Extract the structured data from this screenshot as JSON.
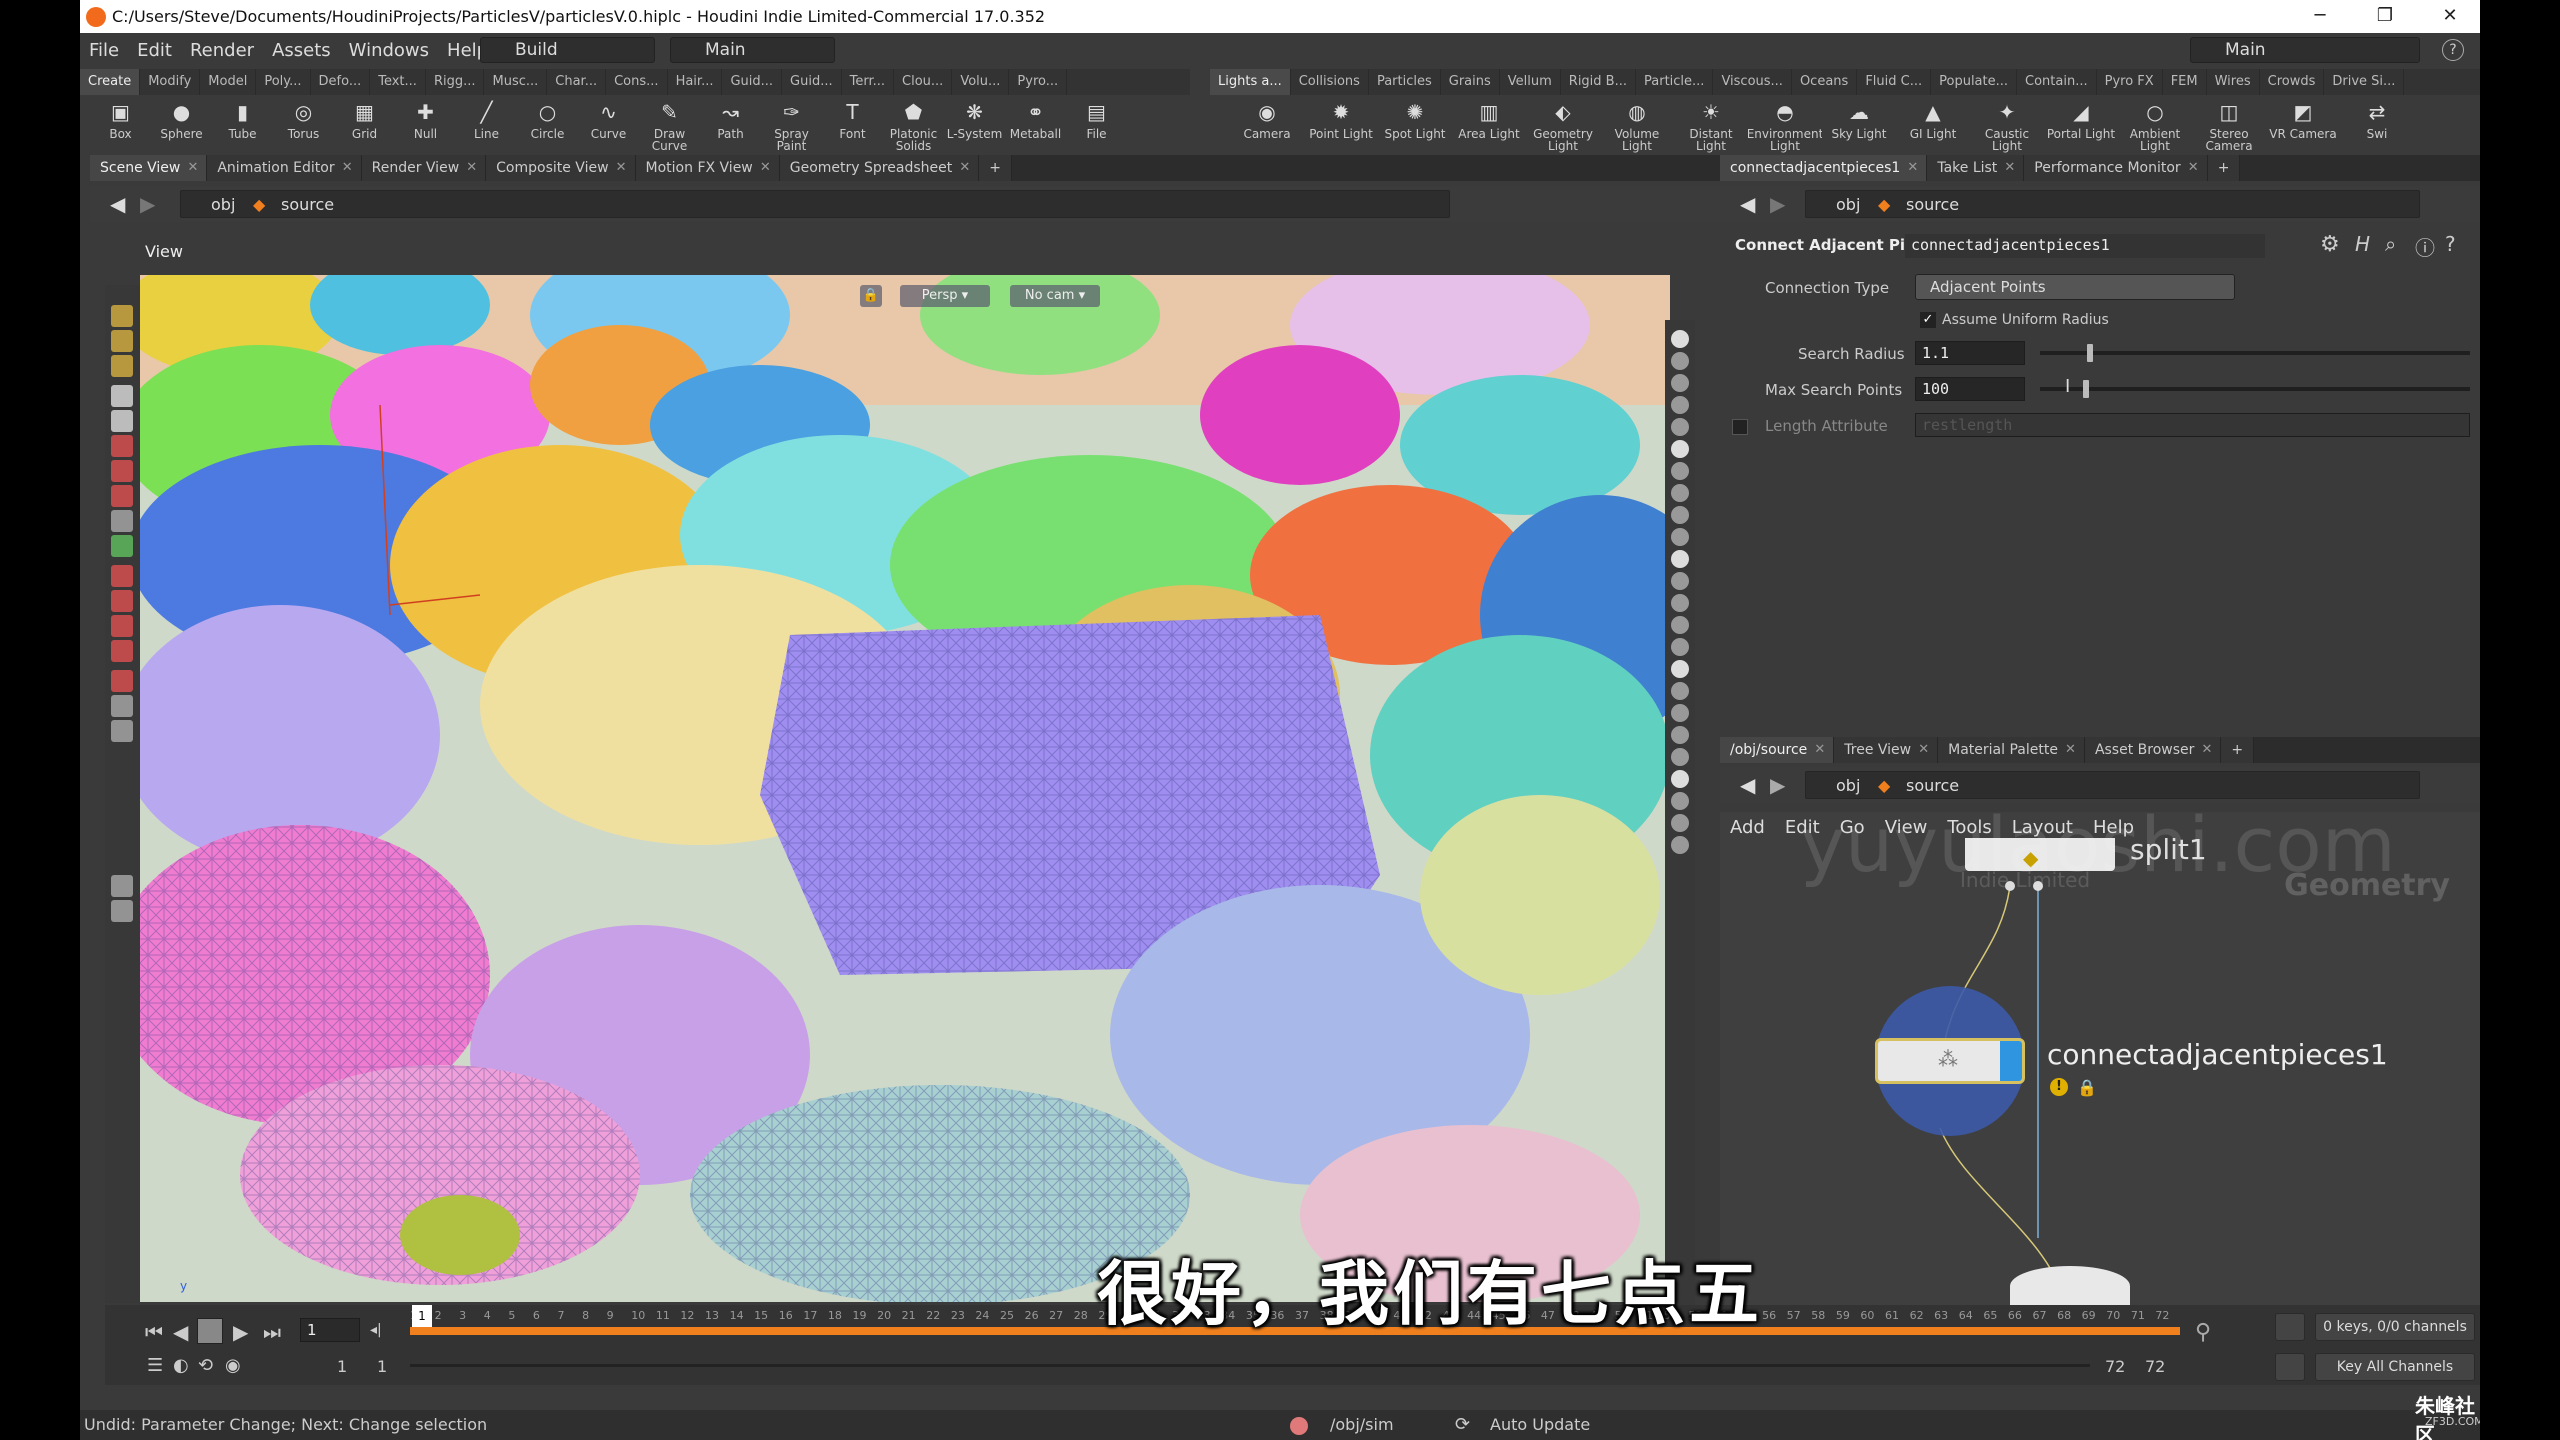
{
  "window": {
    "title": "C:/Users/Steve/Documents/HoudiniProjects/ParticlesV/particlesV.0.hiplc - Houdini Indie Limited-Commercial 17.0.352",
    "minimize": "─",
    "maximize": "❐",
    "close": "✕"
  },
  "menu": {
    "items": [
      "File",
      "Edit",
      "Render",
      "Assets",
      "Windows",
      "Help"
    ],
    "desktop": "Build",
    "main": "Main",
    "main_right": "Main",
    "help_icon": "?"
  },
  "shelf_left": {
    "tabs": [
      "Create",
      "Modify",
      "Model",
      "Poly...",
      "Defo...",
      "Text...",
      "Rigg...",
      "Musc...",
      "Char...",
      "Cons...",
      "Hair...",
      "Guid...",
      "Guid...",
      "Terr...",
      "Clou...",
      "Volu...",
      "Pyro..."
    ],
    "tools": [
      {
        "label": "Box",
        "icon": "box-icon"
      },
      {
        "label": "Sphere",
        "icon": "sphere-icon"
      },
      {
        "label": "Tube",
        "icon": "tube-icon"
      },
      {
        "label": "Torus",
        "icon": "torus-icon"
      },
      {
        "label": "Grid",
        "icon": "grid-icon"
      },
      {
        "label": "Null",
        "icon": "null-icon"
      },
      {
        "label": "Line",
        "icon": "line-icon"
      },
      {
        "label": "Circle",
        "icon": "circle-icon"
      },
      {
        "label": "Curve",
        "icon": "curve-icon"
      },
      {
        "label": "Draw Curve",
        "icon": "draw-curve-icon"
      },
      {
        "label": "Path",
        "icon": "path-icon"
      },
      {
        "label": "Spray Paint",
        "icon": "spray-paint-icon"
      },
      {
        "label": "Font",
        "icon": "font-icon"
      },
      {
        "label": "Platonic Solids",
        "icon": "platonic-icon"
      },
      {
        "label": "L-System",
        "icon": "lsystem-icon"
      },
      {
        "label": "Metaball",
        "icon": "metaball-icon"
      },
      {
        "label": "File",
        "icon": "file-icon"
      }
    ]
  },
  "shelf_right": {
    "tabs": [
      "Lights a...",
      "Collisions",
      "Particles",
      "Grains",
      "Vellum",
      "Rigid B...",
      "Particle...",
      "Viscous...",
      "Oceans",
      "Fluid C...",
      "Populate...",
      "Contain...",
      "Pyro FX",
      "FEM",
      "Wires",
      "Crowds",
      "Drive Si..."
    ],
    "tools": [
      {
        "label": "Camera",
        "icon": "camera-icon"
      },
      {
        "label": "Point Light",
        "icon": "point-light-icon"
      },
      {
        "label": "Spot Light",
        "icon": "spot-light-icon"
      },
      {
        "label": "Area Light",
        "icon": "area-light-icon"
      },
      {
        "label": "Geometry Light",
        "icon": "geometry-light-icon"
      },
      {
        "label": "Volume Light",
        "icon": "volume-light-icon"
      },
      {
        "label": "Distant Light",
        "icon": "distant-light-icon"
      },
      {
        "label": "Environment Light",
        "icon": "environment-light-icon"
      },
      {
        "label": "Sky Light",
        "icon": "sky-light-icon"
      },
      {
        "label": "GI Light",
        "icon": "gi-light-icon"
      },
      {
        "label": "Caustic Light",
        "icon": "caustic-light-icon"
      },
      {
        "label": "Portal Light",
        "icon": "portal-light-icon"
      },
      {
        "label": "Ambient Light",
        "icon": "ambient-light-icon"
      },
      {
        "label": "Stereo Camera",
        "icon": "stereo-camera-icon"
      },
      {
        "label": "VR Camera",
        "icon": "vr-camera-icon"
      },
      {
        "label": "Swi",
        "icon": "switcher-icon"
      }
    ]
  },
  "left_pane": {
    "tabs": [
      "Scene View",
      "Animation Editor",
      "Render View",
      "Composite View",
      "Motion FX View",
      "Geometry Spreadsheet"
    ],
    "path": {
      "obj": "obj",
      "node": "source"
    },
    "view_label": "View",
    "persp": "Persp ▾",
    "cam": "No cam ▾"
  },
  "param_pane": {
    "tabs": [
      "connectadjacentpieces1",
      "Take List",
      "Performance Monitor"
    ],
    "path": {
      "obj": "obj",
      "node": "source"
    },
    "node_type": "Connect Adjacent Pieces",
    "node_name": "connectadjacentpieces1",
    "params": {
      "connection_type_label": "Connection Type",
      "connection_type_value": "Adjacent Points",
      "assume_uniform_label": "Assume Uniform Radius",
      "search_radius_label": "Search Radius",
      "search_radius_value": "1.1",
      "search_radius_fill": 0.11,
      "max_search_label": "Max Search Points",
      "max_search_value": "100",
      "max_search_fill": 0.1,
      "length_attr_label": "Length Attribute",
      "length_attr_value": "restlength"
    }
  },
  "network_pane": {
    "tabs": [
      "/obj/source",
      "Tree View",
      "Material Palette",
      "Asset Browser"
    ],
    "path": {
      "obj": "obj",
      "node": "source"
    },
    "menu": [
      "Add",
      "Edit",
      "Go",
      "View",
      "Tools",
      "Layout",
      "Help"
    ],
    "context_label": "Geometry",
    "context_sub": "Indie Limited",
    "split_node": "split1",
    "selected_node": "connectadjacentpieces1"
  },
  "timeline": {
    "frame": "1",
    "start": "1",
    "start2": "1",
    "end": "72",
    "end2": "72",
    "keys_info": "0 keys, 0/0 channels",
    "key_all": "Key All Channels",
    "ticks": [
      "1",
      "2",
      "3",
      "4",
      "5",
      "6",
      "7",
      "8",
      "9",
      "10",
      "11",
      "12",
      "13",
      "14",
      "15",
      "16",
      "17",
      "18",
      "19",
      "20",
      "21",
      "22",
      "23",
      "24",
      "25",
      "26",
      "27",
      "28",
      "29",
      "30",
      "31",
      "32",
      "33",
      "34",
      "35",
      "36",
      "37",
      "38",
      "39",
      "40",
      "41",
      "42",
      "43",
      "44",
      "45",
      "46",
      "47",
      "48",
      "49",
      "50",
      "51",
      "52",
      "53",
      "54",
      "55",
      "56",
      "57",
      "58",
      "59",
      "60",
      "61",
      "62",
      "63",
      "64",
      "65",
      "66",
      "67",
      "68",
      "69",
      "70",
      "71",
      "72"
    ]
  },
  "status": {
    "message": "Undid: Parameter Change; Next: Change selection",
    "sim_path": "/obj/sim",
    "auto_update": "Auto Update"
  },
  "subtitle": "很好，我们有七点五",
  "watermark": "yuyulaoshi.com",
  "corner_logo": "朱峰社区",
  "corner_logo_sub": "ZF3D.COM",
  "colors": {
    "accent_orange": "#f0801e",
    "selected_node_blue": "#2f95e0",
    "node_ring": "#3c5aa8"
  }
}
